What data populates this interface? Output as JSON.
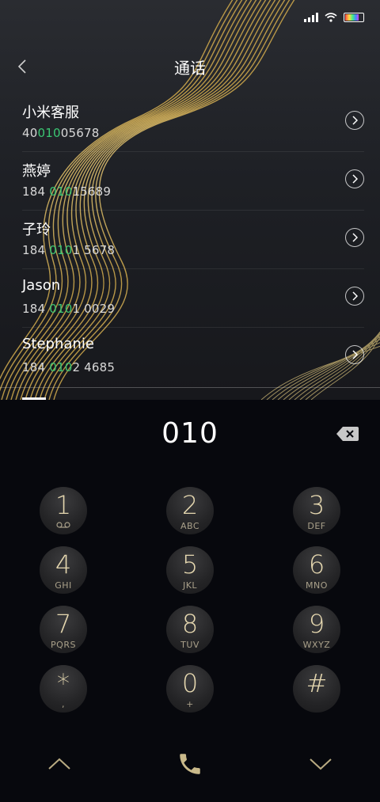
{
  "status": {
    "time": "",
    "carrier": ""
  },
  "header": {
    "title": "通话"
  },
  "contacts": [
    {
      "name": "小米客服",
      "num_pre": "40",
      "num_hl": "010",
      "num_post": "05678"
    },
    {
      "name": "燕婷",
      "num_pre": "184 ",
      "num_hl": "010",
      "num_post": "15689"
    },
    {
      "name": "子玲",
      "num_pre": "184 ",
      "num_hl": "010",
      "num_post": "1 5678"
    },
    {
      "name": "Jason",
      "num_pre": "184 ",
      "num_hl": "010",
      "num_post": "1 0029"
    },
    {
      "name": "Stephanie",
      "num_pre": "184 ",
      "num_hl": "010",
      "num_post": "2 4685"
    }
  ],
  "dialer": {
    "entered": "010",
    "keys": [
      {
        "digit": "1",
        "letters": ""
      },
      {
        "digit": "2",
        "letters": "ABC"
      },
      {
        "digit": "3",
        "letters": "DEF"
      },
      {
        "digit": "4",
        "letters": "GHI"
      },
      {
        "digit": "5",
        "letters": "JKL"
      },
      {
        "digit": "6",
        "letters": "MNO"
      },
      {
        "digit": "7",
        "letters": "PQRS"
      },
      {
        "digit": "8",
        "letters": "TUV"
      },
      {
        "digit": "9",
        "letters": "WXYZ"
      },
      {
        "digit": "*",
        "letters": ","
      },
      {
        "digit": "0",
        "letters": "+"
      },
      {
        "digit": "#",
        "letters": ""
      }
    ]
  },
  "icons": {
    "back": "chevron-left-icon",
    "detail": "chevron-right-circle-icon",
    "backspace": "backspace-icon",
    "voicemail": "voicemail-icon",
    "collapse_up": "chevron-up-icon",
    "call": "phone-icon",
    "collapse_down": "chevron-down-icon"
  },
  "colors": {
    "highlight": "#3bc673",
    "key_digit": "#e6d8b0",
    "call_icon": "#c9b98a"
  }
}
